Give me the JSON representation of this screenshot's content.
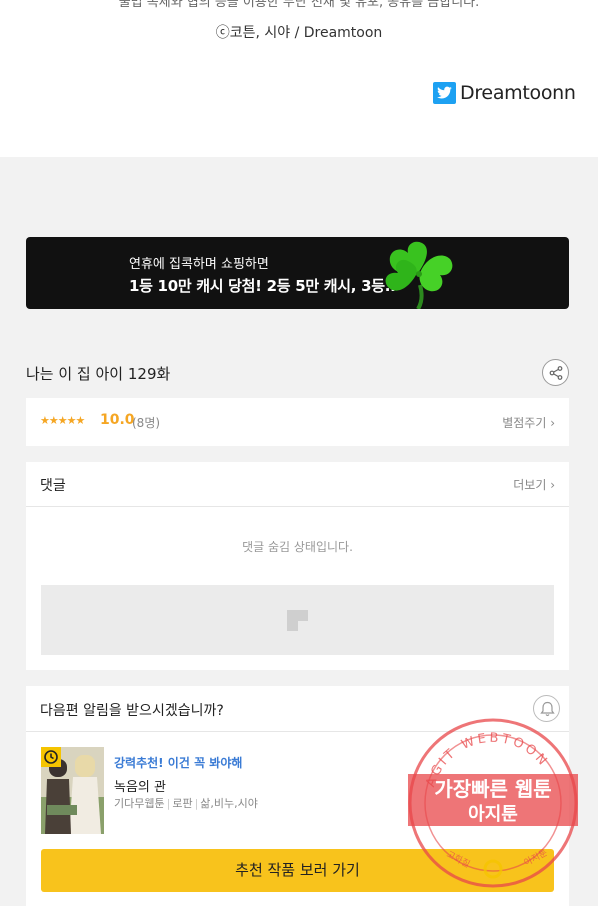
{
  "top": {
    "cut_text": "불법 복제와 협의 등을 이용한 무단 전재 및 유포, 공유를 금합니다.",
    "copyright": "ⓒ코튼, 시야 / Dreamtoon",
    "twitter_label": "Dreamtoonn"
  },
  "banner": {
    "line1": "연휴에 집콕하며 쇼핑하면",
    "line2": "1등 10만 캐시 당첨! 2등 5만 캐시, 3등.."
  },
  "episode": {
    "title": "나는 이 집 아이 129화"
  },
  "rating": {
    "stars": "★★★★★",
    "score": "10.0",
    "count": "(8명)",
    "give_label": "별점주기 ›"
  },
  "comments": {
    "header": "댓글",
    "more_label": "더보기 ›",
    "hidden_text": "댓글 숨김 상태입니다."
  },
  "notify": {
    "header": "다음편 알림을 받으시겠습니까?",
    "rec_tag": "강력추천! 이건 꼭 봐야해",
    "rec_title": "녹음의 관",
    "genre1": "기다무웹툰",
    "genre2": "로판",
    "genre3": "삶,비누,시야",
    "cta_label": "추천 작품 보러 가기"
  },
  "watermark": {
    "ring_text": "AGIT WEBTOON",
    "line1": "가장빠른 웹툰",
    "line2": "아지툰",
    "small_left": "고화질",
    "small_right": "아지툰"
  },
  "colors": {
    "accent_yellow": "#f8c31c",
    "star_orange": "#f5a623",
    "link_blue": "#3a7bd5",
    "twitter_blue": "#1da1f2",
    "stamp_red": "#e8474a"
  },
  "icons": {
    "twitter": "twitter-icon",
    "share": "share-icon",
    "bell": "bell-icon",
    "clock": "clock-icon",
    "clover": "clover-icon"
  }
}
